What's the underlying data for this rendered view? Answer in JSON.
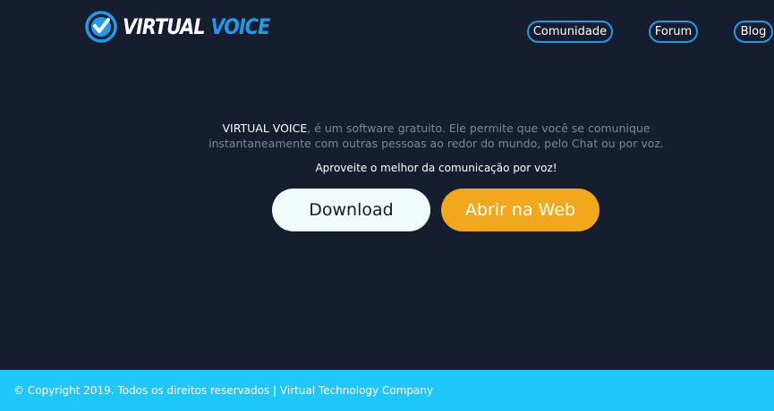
{
  "header": {
    "logo": {
      "word1": "VIRTUAL",
      "word2": "VOICE",
      "icon": "checkmark-circle-icon"
    },
    "nav": [
      {
        "label": "Comunidade"
      },
      {
        "label": "Forum"
      },
      {
        "label": "Blog"
      }
    ]
  },
  "hero": {
    "brand": "VIRTUAL VOICE",
    "description_part1": ", é um software gratuito. Ele permite que você se comunique",
    "description_part2": "instantaneamente com outras pessoas ao redor do mundo, pelo Chat ou por voz.",
    "tagline": "Aproveite o melhor da comunicação por voz!",
    "download_label": "Download",
    "web_label": "Abrir na Web"
  },
  "footer": {
    "text": "© Copyright 2019. Todos os direitos reservados | Virtual Technology Company"
  },
  "colors": {
    "background": "#161d2e",
    "accent_blue": "#1e9bea",
    "footer_bg": "#1ec8fb",
    "download_bg": "#f2fcfd",
    "web_bg": "#f2a81c",
    "muted_text": "#7e8796"
  }
}
